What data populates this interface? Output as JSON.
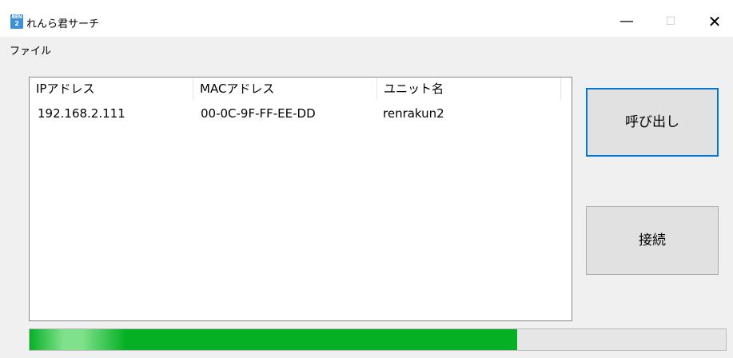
{
  "window": {
    "title": "れんら君サーチ",
    "icon_text_top": "REN",
    "icon_text_bottom": "2",
    "minimize_glyph": "—",
    "maximize_glyph": "☐",
    "close_glyph": "✕"
  },
  "menu": {
    "items": [
      {
        "label": "ファイル"
      }
    ]
  },
  "table": {
    "columns": [
      "IPアドレス",
      "MACアドレス",
      "ユニット名"
    ],
    "rows": [
      [
        "192.168.2.111",
        "00-0C-9F-FF-EE-DD",
        "renrakun2"
      ]
    ]
  },
  "buttons": {
    "call_label": "呼び出し",
    "connect_label": "接続"
  },
  "progress": {
    "value_fraction": 0.7,
    "fill_color": "#06b025"
  }
}
